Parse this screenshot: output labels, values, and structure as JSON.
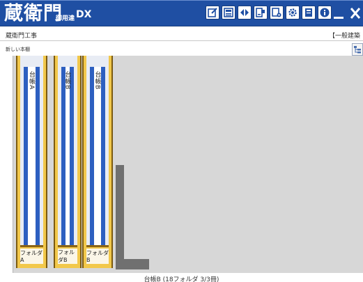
{
  "app": {
    "logo_main": "蔵衛門",
    "logo_sub": "御用達",
    "logo_dx": "DX"
  },
  "toolbar": {
    "icons": [
      "edit-icon",
      "image-icon",
      "split-icon",
      "document-tag-icon",
      "edit-settings-icon",
      "gear-icon",
      "book-icon",
      "info-icon"
    ]
  },
  "window_controls": {
    "minimize": "minimize-icon",
    "close": "close-icon"
  },
  "header": {
    "breadcrumb": "蔵衛門工事",
    "category": "【一般建築",
    "sub_breadcrumb": "新しい本棚"
  },
  "binders": [
    {
      "spine_label": "台帳A",
      "folder_label": "フォルダA"
    },
    {
      "spine_label": "台帳B",
      "folder_label": "フォルダB"
    },
    {
      "spine_label": "台帳B",
      "folder_label": "フォルダB"
    }
  ],
  "status": {
    "text": "台帳B (18フォルダ 3/3冊)"
  },
  "colors": {
    "titlebar": "#1f4fa3",
    "binder": "#f2c84b",
    "spine": "#2d5fc0",
    "shelf": "#d7d7d7"
  }
}
